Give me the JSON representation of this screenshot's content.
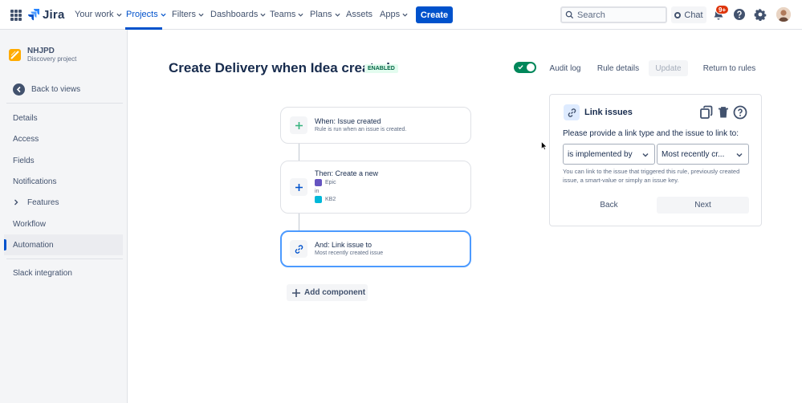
{
  "nav": {
    "logo_text": "Jira",
    "items": [
      {
        "label": "Your work",
        "has_chevron": true
      },
      {
        "label": "Projects",
        "has_chevron": true,
        "active": true
      },
      {
        "label": "Filters",
        "has_chevron": true
      },
      {
        "label": "Dashboards",
        "has_chevron": true
      },
      {
        "label": "Teams",
        "has_chevron": true
      },
      {
        "label": "Plans",
        "has_chevron": true
      },
      {
        "label": "Assets",
        "has_chevron": false
      },
      {
        "label": "Apps",
        "has_chevron": true
      }
    ],
    "create_label": "Create",
    "search_placeholder": "Search",
    "chat_label": "Chat",
    "notifications_badge": "9+",
    "icons": [
      "app-switcher-icon",
      "search-icon",
      "bell-icon",
      "help-icon",
      "settings-icon"
    ]
  },
  "sidebar": {
    "project_name": "NHJPD",
    "project_type": "Discovery project",
    "back_label": "Back to views",
    "items": [
      {
        "label": "Details"
      },
      {
        "label": "Access"
      },
      {
        "label": "Fields"
      },
      {
        "label": "Notifications"
      },
      {
        "label": "Features",
        "expandable": true
      },
      {
        "label": "Workflow"
      },
      {
        "label": "Automation",
        "active": true
      }
    ],
    "footer_item": "Slack integration"
  },
  "main": {
    "title": "Create Delivery when Idea created",
    "status_badge": "ENABLED",
    "rule_enabled": true,
    "actions": {
      "audit_log": "Audit log",
      "rule_details": "Rule details",
      "update": "Update",
      "return": "Return to rules"
    },
    "flow": [
      {
        "title": "When: Issue created",
        "subtitle": "Rule is run when an issue is created."
      },
      {
        "title": "Then: Create a new",
        "issue_type": "Epic",
        "connector": "in",
        "project": "KB2"
      },
      {
        "title": "And: Link issue to",
        "subtitle": "Most recently created issue",
        "selected": true
      }
    ],
    "add_component": "Add component"
  },
  "panel": {
    "title": "Link issues",
    "prompt": "Please provide a link type and the issue to link to:",
    "link_type": "is implemented by",
    "link_target": "Most recently cr...",
    "helper": "You can link to the issue that triggered this rule, previously created issue, a smart-value or simply an issue key.",
    "back_label": "Back",
    "next_label": "Next",
    "icons": [
      "copy-icon",
      "trash-icon",
      "help-icon"
    ]
  },
  "colors": {
    "brand": "#0052CC",
    "toggle_on": "#00875A",
    "enabled_bg": "#E3FCEF",
    "enabled_text": "#006644",
    "notification": "#DE350B",
    "project_icon": "#FFAB00",
    "epic": "#6554C0",
    "selected_border": "#4C9AFF"
  }
}
